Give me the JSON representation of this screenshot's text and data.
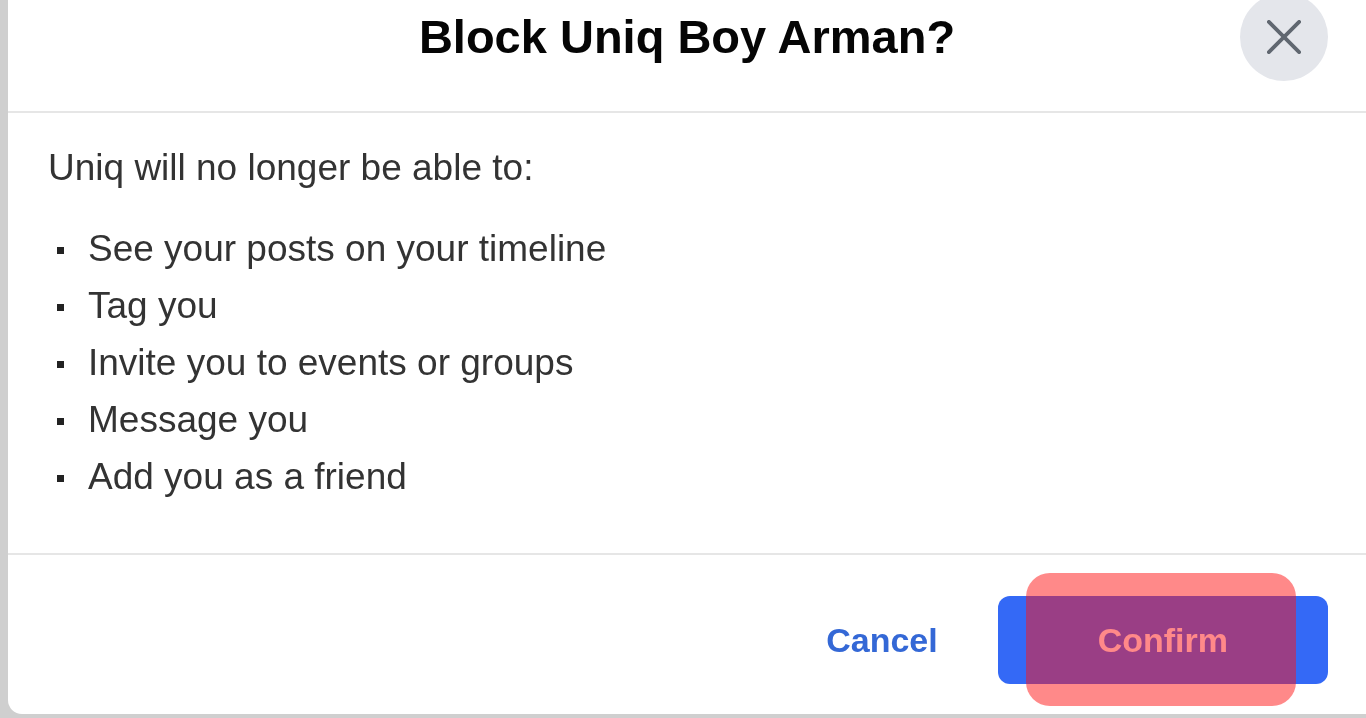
{
  "dialog": {
    "title": "Block Uniq Boy Arman?",
    "intro": "Uniq will no longer be able to:",
    "restrictions": [
      "See your posts on your timeline",
      "Tag you",
      "Invite you to events or groups",
      "Message you",
      "Add you as a friend"
    ],
    "buttons": [
      {
        "label": "Cancel",
        "kind": "link",
        "highlighted": false
      },
      {
        "label": "Confirm",
        "kind": "primary",
        "highlighted": true
      }
    ]
  }
}
